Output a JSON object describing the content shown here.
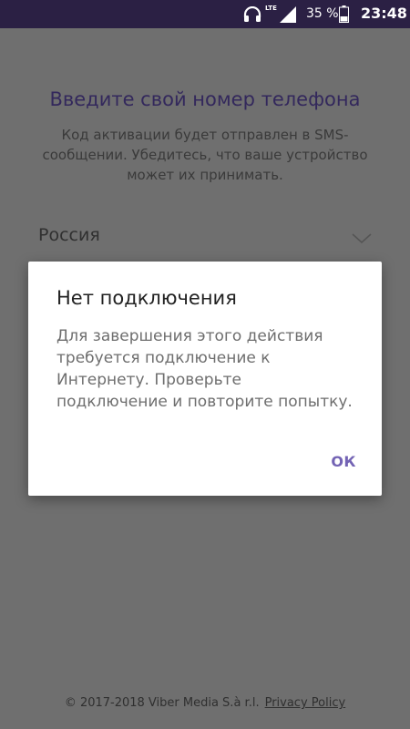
{
  "status_bar": {
    "network": "LTE",
    "battery": "35 %",
    "time": "23:48",
    "icons": [
      "headset-icon",
      "signal-icon",
      "battery-icon"
    ]
  },
  "screen": {
    "title": "Введите свой номер телефона",
    "subtitle": "Код активации будет отправлен в SMS-сообщении. Убедитесь, что ваше устройство может их принимать.",
    "country": "Россия",
    "footer_copyright": "© 2017-2018 Viber Media S.à r.l.",
    "footer_privacy": "Privacy Policy"
  },
  "dialog": {
    "title": "Нет подключения",
    "message": "Для завершения этого действия требуется подключение к Интернету. Проверьте подключение и повторите попытку.",
    "ok_label": "ОК"
  },
  "colors": {
    "status_bar_bg": "#2b2044",
    "title_purple": "#33285c",
    "accent": "#7363b4",
    "overlay": "#6f6f6f"
  }
}
